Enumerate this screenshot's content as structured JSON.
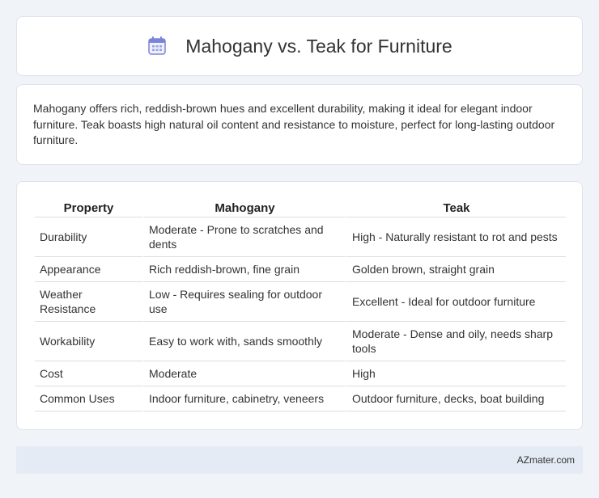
{
  "header": {
    "title": "Mahogany vs. Teak for Furniture",
    "icon": "calendar-icon",
    "icon_color": "#7b84d9"
  },
  "description": "Mahogany offers rich, reddish-brown hues and excellent durability, making it ideal for elegant indoor furniture. Teak boasts high natural oil content and resistance to moisture, perfect for long-lasting outdoor furniture.",
  "table": {
    "headers": [
      "Property",
      "Mahogany",
      "Teak"
    ],
    "rows": [
      [
        "Durability",
        "Moderate - Prone to scratches and dents",
        "High - Naturally resistant to rot and pests"
      ],
      [
        "Appearance",
        "Rich reddish-brown, fine grain",
        "Golden brown, straight grain"
      ],
      [
        "Weather Resistance",
        "Low - Requires sealing for outdoor use",
        "Excellent - Ideal for outdoor furniture"
      ],
      [
        "Workability",
        "Easy to work with, sands smoothly",
        "Moderate - Dense and oily, needs sharp tools"
      ],
      [
        "Cost",
        "Moderate",
        "High"
      ],
      [
        "Common Uses",
        "Indoor furniture, cabinetry, veneers",
        "Outdoor furniture, decks, boat building"
      ]
    ]
  },
  "footer": {
    "brand": "AZmater.com"
  }
}
